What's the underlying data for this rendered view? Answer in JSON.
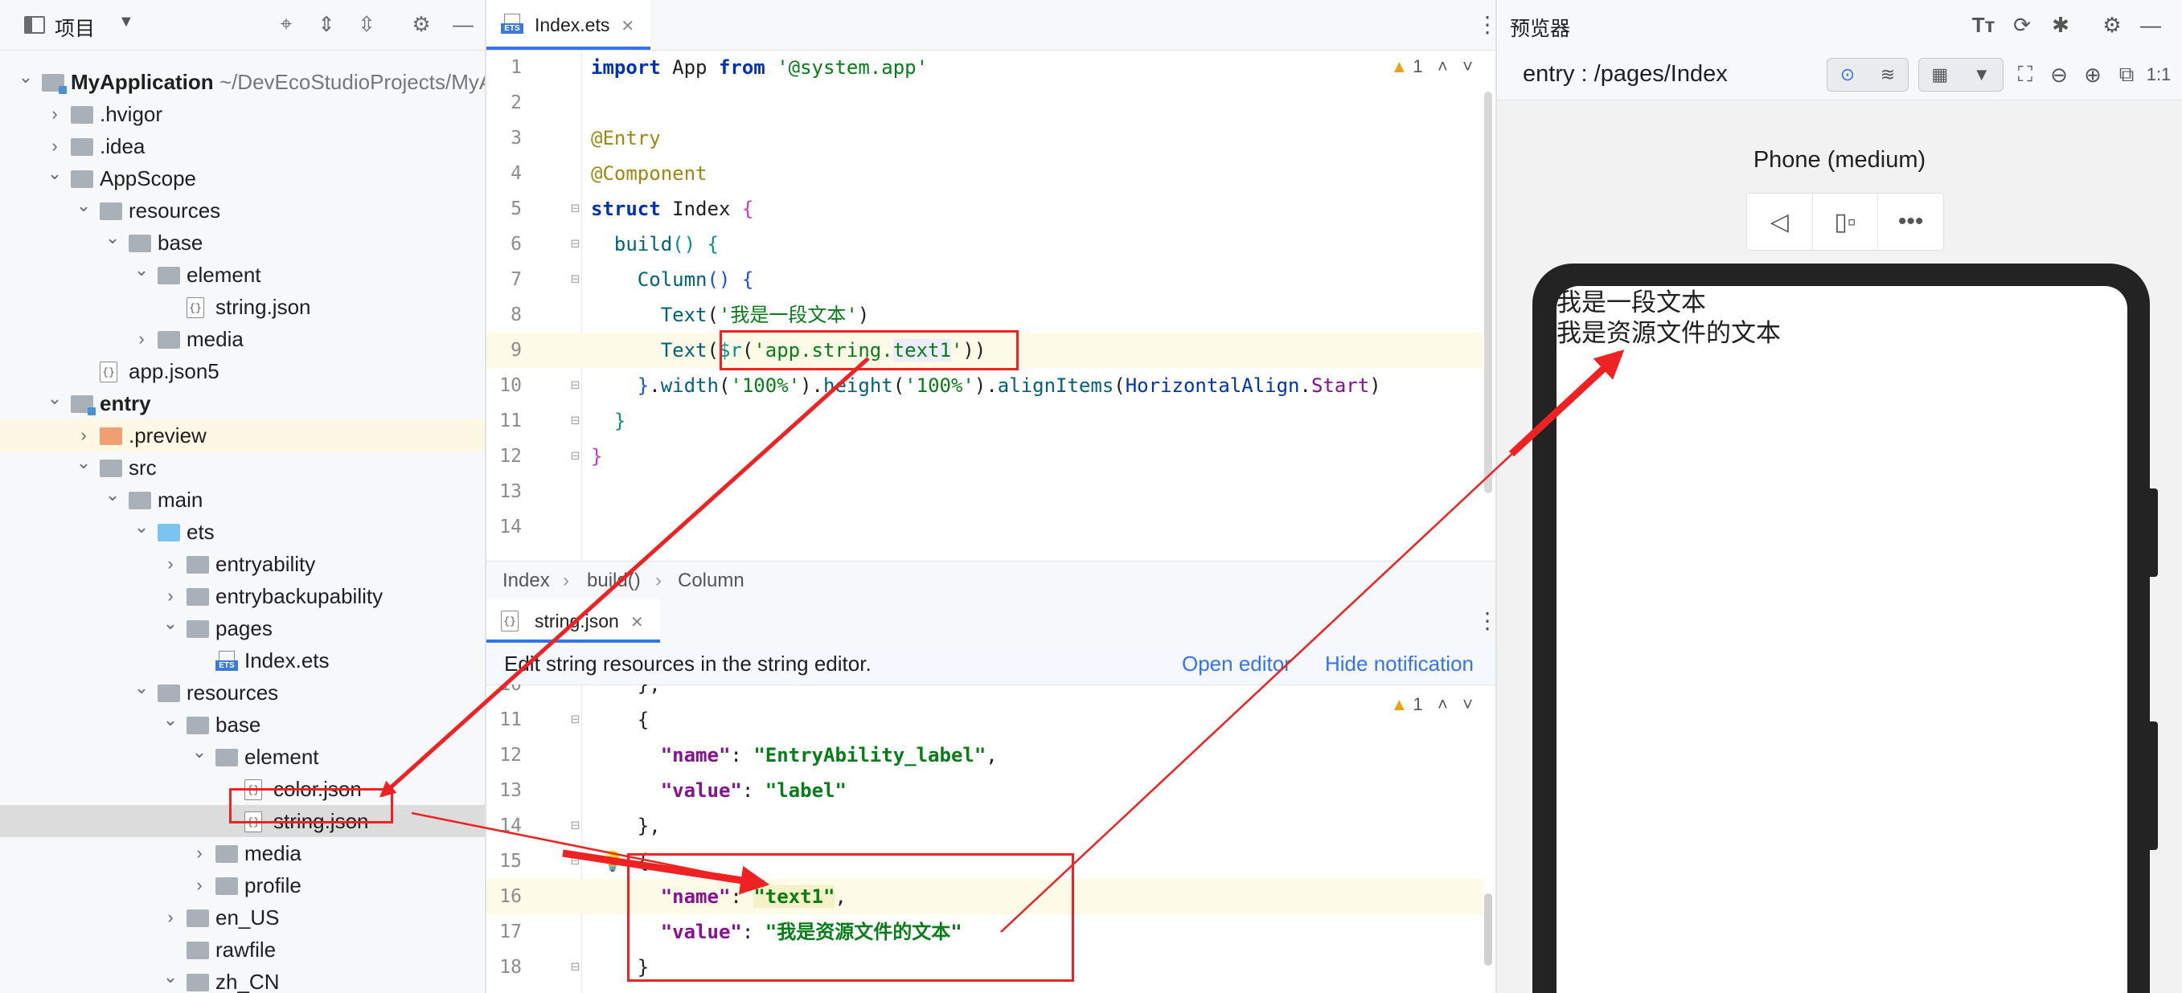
{
  "project": {
    "title": "项目",
    "toolbar_icons": [
      "target-icon",
      "expand-all-icon",
      "collapse-all-icon",
      "gear-icon",
      "minimize-icon"
    ],
    "tree": [
      {
        "label": "MyApplication",
        "path": " ~/DevEcoStudioProjects/MyApplication",
        "depth": 0,
        "arrow": "down",
        "icon": "module-folder",
        "bold": true
      },
      {
        "label": ".hvigor",
        "depth": 1,
        "arrow": "right",
        "icon": "folder"
      },
      {
        "label": ".idea",
        "depth": 1,
        "arrow": "right",
        "icon": "folder"
      },
      {
        "label": "AppScope",
        "depth": 1,
        "arrow": "down",
        "icon": "folder"
      },
      {
        "label": "resources",
        "depth": 2,
        "arrow": "down",
        "icon": "folder"
      },
      {
        "label": "base",
        "depth": 3,
        "arrow": "down",
        "icon": "folder"
      },
      {
        "label": "element",
        "depth": 4,
        "arrow": "down",
        "icon": "folder"
      },
      {
        "label": "string.json",
        "depth": 5,
        "arrow": "",
        "icon": "json"
      },
      {
        "label": "media",
        "depth": 4,
        "arrow": "right",
        "icon": "folder"
      },
      {
        "label": "app.json5",
        "depth": 2,
        "arrow": "",
        "icon": "json"
      },
      {
        "label": "entry",
        "depth": 1,
        "arrow": "down",
        "icon": "module-folder",
        "bold": true
      },
      {
        "label": ".preview",
        "depth": 2,
        "arrow": "right",
        "icon": "orange-folder",
        "highlight": true
      },
      {
        "label": "src",
        "depth": 2,
        "arrow": "down",
        "icon": "folder"
      },
      {
        "label": "main",
        "depth": 3,
        "arrow": "down",
        "icon": "folder"
      },
      {
        "label": "ets",
        "depth": 4,
        "arrow": "down",
        "icon": "blue-folder"
      },
      {
        "label": "entryability",
        "depth": 5,
        "arrow": "right",
        "icon": "folder"
      },
      {
        "label": "entrybackupability",
        "depth": 5,
        "arrow": "right",
        "icon": "folder"
      },
      {
        "label": "pages",
        "depth": 5,
        "arrow": "down",
        "icon": "folder"
      },
      {
        "label": "Index.ets",
        "depth": 6,
        "arrow": "",
        "icon": "ets"
      },
      {
        "label": "resources",
        "depth": 4,
        "arrow": "down",
        "icon": "folder"
      },
      {
        "label": "base",
        "depth": 5,
        "arrow": "down",
        "icon": "folder"
      },
      {
        "label": "element",
        "depth": 6,
        "arrow": "down",
        "icon": "folder"
      },
      {
        "label": "color.json",
        "depth": 7,
        "arrow": "",
        "icon": "json"
      },
      {
        "label": "string.json",
        "depth": 7,
        "arrow": "",
        "icon": "json",
        "selected": true
      },
      {
        "label": "media",
        "depth": 6,
        "arrow": "right",
        "icon": "folder"
      },
      {
        "label": "profile",
        "depth": 6,
        "arrow": "right",
        "icon": "folder"
      },
      {
        "label": "en_US",
        "depth": 5,
        "arrow": "right",
        "icon": "folder"
      },
      {
        "label": "rawfile",
        "depth": 5,
        "arrow": "",
        "icon": "folder"
      },
      {
        "label": "zh_CN",
        "depth": 5,
        "arrow": "down",
        "icon": "folder"
      }
    ]
  },
  "editor_top": {
    "tab_label": "Index.ets",
    "tab_icon": "ets-file-icon",
    "warning_count": "1",
    "lines": [
      {
        "n": "1",
        "html": "<span class=\"k\">import</span> App <span class=\"k\">from</span> <span class=\"str\">'@system.app'</span>"
      },
      {
        "n": "2",
        "html": ""
      },
      {
        "n": "3",
        "html": "<span class=\"dec\">@Entry</span>"
      },
      {
        "n": "4",
        "html": "<span class=\"dec\">@Component</span>"
      },
      {
        "n": "5",
        "html": "<span class=\"k\">struct</span> <span class=\"kw\">Index</span> <span class=\"pink\">{</span>"
      },
      {
        "n": "6",
        "html": "  <span class=\"fn\">build</span><span class=\"teal\">()</span> <span class=\"teal\">{</span>"
      },
      {
        "n": "7",
        "html": "    <span class=\"fn\">Column</span><span class=\"blue\">()</span> <span class=\"blue\">{</span>"
      },
      {
        "n": "8",
        "html": "      <span class=\"fn\">Text</span>(<span class=\"str\">'我是一段文本'</span>)"
      },
      {
        "n": "9",
        "html": "      <span class=\"fn\">Text</span>(<span class=\"teal\">$r</span>(<span class=\"str\">'app.string.<span class=\"hlstr\">text1</span>'</span>))"
      },
      {
        "n": "10",
        "html": "    <span class=\"blue\">}</span>.<span class=\"fn\">width</span>(<span class=\"str\">'100%'</span>).<span class=\"fn\">height</span>(<span class=\"str\">'100%'</span>).<span class=\"fn\">alignItems</span>(<span class=\"kw\" style=\"color:#0033b3\">HorizontalAlign</span>.<span class=\"purp\" style=\"font-weight:normal\">Start</span>)"
      },
      {
        "n": "11",
        "html": "  <span class=\"teal\">}</span>"
      },
      {
        "n": "12",
        "html": "<span class=\"pink\">}</span>"
      },
      {
        "n": "13",
        "html": ""
      },
      {
        "n": "14",
        "html": ""
      }
    ],
    "breadcrumb": [
      "Index",
      "build()",
      "Column"
    ]
  },
  "editor_bottom": {
    "tab_label": "string.json",
    "notification": "Edit string resources in the string editor.",
    "open_editor": "Open editor",
    "hide_notification": "Hide notification",
    "warning_count": "1",
    "lines": [
      {
        "n": "10",
        "html": "    },"
      },
      {
        "n": "11",
        "html": "    {"
      },
      {
        "n": "12",
        "html": "      <span class=\"purp\">\"name\"</span>: <span class=\"gstr\">\"EntryAbility_label\"</span>,"
      },
      {
        "n": "13",
        "html": "      <span class=\"purp\">\"value\"</span>: <span class=\"gstr\">\"label\"</span>"
      },
      {
        "n": "14",
        "html": "    },"
      },
      {
        "n": "15",
        "html": "    {"
      },
      {
        "n": "16",
        "html": "      <span class=\"purp\">\"name\"</span>: <span class=\"gstr\" style=\"background:#f5f2c8\">\"text1\"</span>,"
      },
      {
        "n": "17",
        "html": "      <span class=\"purp\">\"value\"</span>: <span class=\"gstr\">\"我是资源文件的文本\"</span>"
      },
      {
        "n": "18",
        "html": "    }"
      }
    ]
  },
  "previewer": {
    "title": "预览器",
    "route": "entry : /pages/Index",
    "device": "Phone (medium)",
    "ratio": "1:1",
    "texts": [
      "我是一段文本",
      "我是资源文件的文本"
    ]
  }
}
